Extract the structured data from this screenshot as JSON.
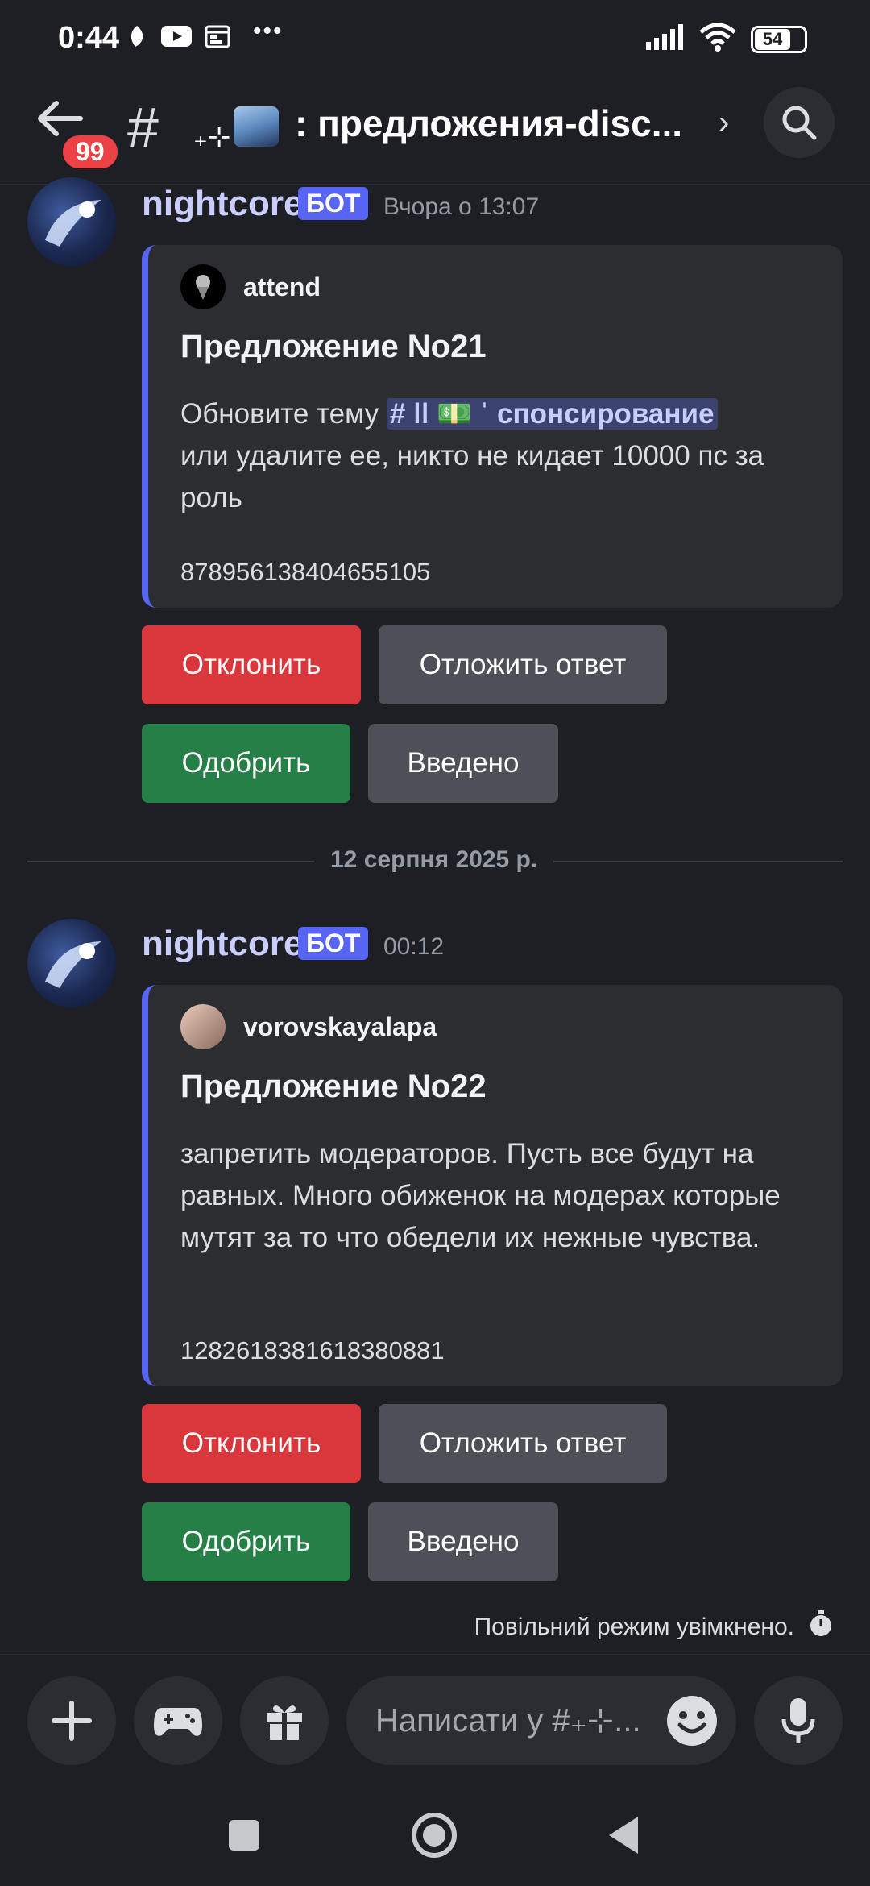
{
  "status_bar": {
    "time": "0:44",
    "battery": "54",
    "overflow": "•••"
  },
  "header": {
    "back_badge": "99",
    "channel_hash": "#",
    "channel_sparkle": "₊⊹",
    "channel_name": ": предложения-disc..."
  },
  "messages": [
    {
      "username": "nightcore",
      "bot_tag": "БОТ",
      "timestamp": "Вчора о 13:07",
      "embed": {
        "author": "attend",
        "title": "Предложение No21",
        "desc_before": "Обновите тему",
        "mention": "# ǀǀ 💵 ˈ спонсирование",
        "desc_after": "или удалите ее, никто не кидает 10000 пс за роль",
        "footer": "878956138404655105"
      },
      "buttons": {
        "reject": "Отклонить",
        "postpone": "Отложить ответ",
        "approve": "Одобрить",
        "implemented": "Введено"
      }
    },
    {
      "username": "nightcore",
      "bot_tag": "БОТ",
      "timestamp": "00:12",
      "embed": {
        "author": "vorovskayalapa",
        "title": "Предложение No22",
        "description": "запретить модераторов. Пусть все будут на равных. Много обиженок на модерах которые мутят за то что обедели их нежные чувства.",
        "footer": "1282618381618380881"
      },
      "buttons": {
        "reject": "Отклонить",
        "postpone": "Отложить ответ",
        "approve": "Одобрить",
        "implemented": "Введено"
      }
    }
  ],
  "date_divider": "12 серпня 2025 р.",
  "slowmode": "Повільний режим увімкнено.",
  "composer": {
    "placeholder": "Написати у #₊⊹..."
  },
  "colors": {
    "background": "#1e1f24",
    "embed_bg": "#2b2d31",
    "accent": "#5865f2",
    "danger": "#da373c",
    "success": "#248046",
    "secondary": "#4e5058",
    "username": "#c9cdfb"
  }
}
